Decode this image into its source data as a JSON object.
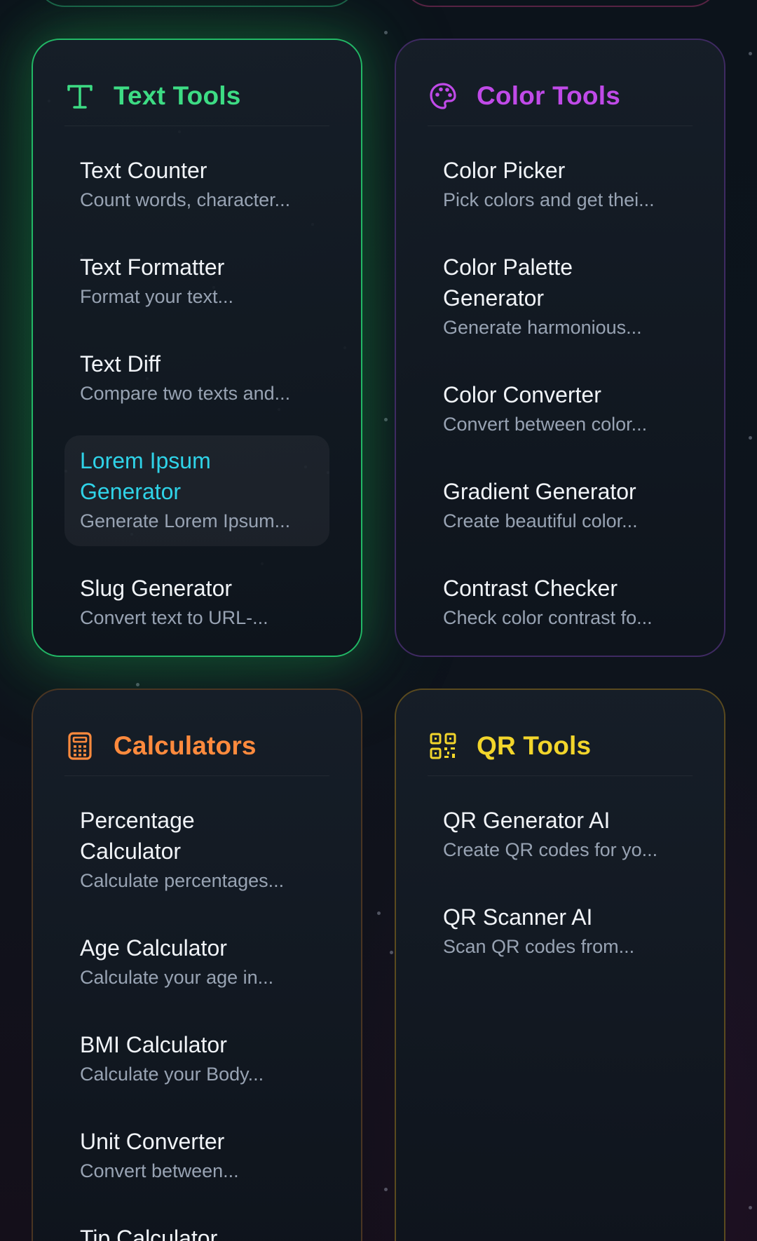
{
  "colors": {
    "text_accent": "#3ddc84",
    "color_accent": "#c04ae8",
    "calc_accent": "#ff8a3d",
    "qr_accent": "#f2d52b",
    "active_item": "#2fd3e8"
  },
  "sections": {
    "text": {
      "title": "Text Tools",
      "icon": "text-t-icon",
      "items": [
        {
          "name": "Text Counter",
          "desc": "Count words, character..."
        },
        {
          "name": "Text Formatter",
          "desc": "Format your text..."
        },
        {
          "name": "Text Diff",
          "desc": "Compare two texts and..."
        },
        {
          "name": "Lorem Ipsum Generator",
          "desc": "Generate Lorem Ipsum...",
          "active": true
        },
        {
          "name": "Slug Generator",
          "desc": "Convert text to URL-..."
        }
      ]
    },
    "color": {
      "title": "Color Tools",
      "icon": "palette-icon",
      "items": [
        {
          "name": "Color Picker",
          "desc": "Pick colors and get thei..."
        },
        {
          "name": "Color Palette Generator",
          "desc": "Generate harmonious..."
        },
        {
          "name": "Color Converter",
          "desc": "Convert between color..."
        },
        {
          "name": "Gradient Generator",
          "desc": "Create beautiful color..."
        },
        {
          "name": "Contrast Checker",
          "desc": "Check color contrast fo..."
        }
      ]
    },
    "calc": {
      "title": "Calculators",
      "icon": "calculator-icon",
      "items": [
        {
          "name": "Percentage Calculator",
          "desc": "Calculate percentages..."
        },
        {
          "name": "Age Calculator",
          "desc": "Calculate your age in..."
        },
        {
          "name": "BMI Calculator",
          "desc": "Calculate your Body..."
        },
        {
          "name": "Unit Converter",
          "desc": "Convert between..."
        },
        {
          "name": "Tip Calculator",
          "desc": ""
        }
      ]
    },
    "qr": {
      "title": "QR Tools",
      "icon": "qr-code-icon",
      "items": [
        {
          "name": "QR Generator AI",
          "desc": "Create QR codes for yo..."
        },
        {
          "name": "QR Scanner AI",
          "desc": "Scan QR codes from..."
        }
      ]
    }
  }
}
